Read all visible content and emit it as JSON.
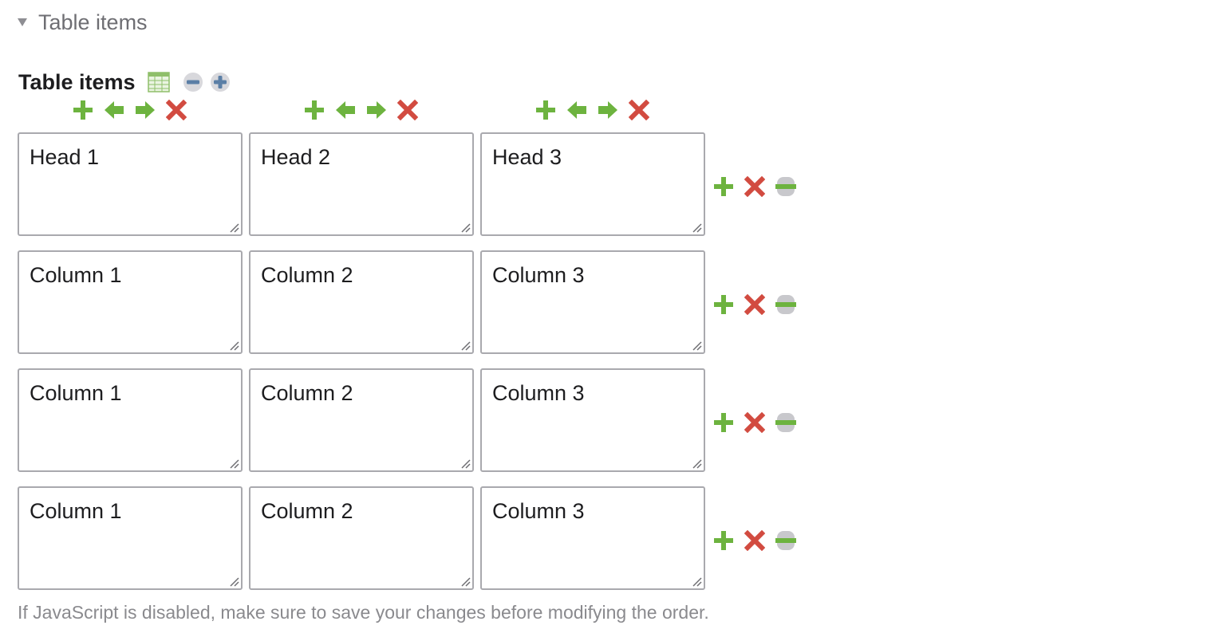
{
  "section": {
    "title": "Table items",
    "collapse_icon": "triangle-down-icon"
  },
  "field": {
    "label": "Table items",
    "icons": [
      "table-icon",
      "minus-circle-icon",
      "plus-circle-icon"
    ]
  },
  "column_controls": {
    "icons": [
      "add-column-icon",
      "move-left-icon",
      "move-right-icon",
      "delete-column-icon"
    ]
  },
  "table": {
    "rows": [
      {
        "cells": [
          "Head 1",
          "Head 2",
          "Head 3"
        ]
      },
      {
        "cells": [
          "Column 1",
          "Column 2",
          "Column 3"
        ]
      },
      {
        "cells": [
          "Column 1",
          "Column 2",
          "Column 3"
        ]
      },
      {
        "cells": [
          "Column 1",
          "Column 2",
          "Column 3"
        ]
      }
    ]
  },
  "row_controls": {
    "icons": [
      "add-row-icon",
      "delete-row-icon",
      "drag-handle-icon"
    ]
  },
  "colors": {
    "green": "#6db33f",
    "red": "#d24b40",
    "blue": "#5b7fa6",
    "gray": "#c8c8cc"
  },
  "help_text": "If JavaScript is disabled, make sure to save your changes before modifying the order."
}
